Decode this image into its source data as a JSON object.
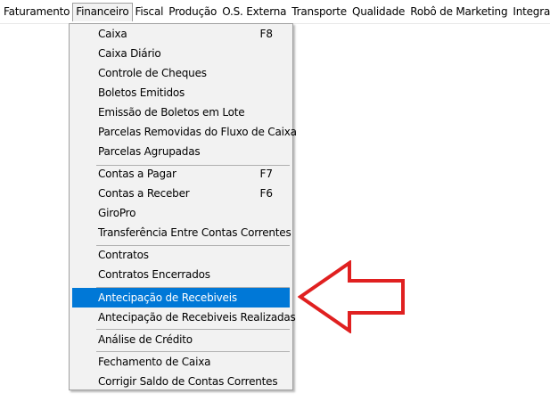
{
  "menubar": {
    "items": [
      {
        "label": "Faturamento"
      },
      {
        "label": "Financeiro"
      },
      {
        "label": "Fiscal"
      },
      {
        "label": "Produção"
      },
      {
        "label": "O.S. Externa"
      },
      {
        "label": "Transporte"
      },
      {
        "label": "Qualidade"
      },
      {
        "label": "Robô de Marketing"
      },
      {
        "label": "Integração"
      }
    ],
    "open_item": "Financeiro"
  },
  "dropdown": {
    "items": [
      {
        "label": "Caixa",
        "shortcut": "F8"
      },
      {
        "label": "Caixa Diário"
      },
      {
        "label": "Controle de Cheques"
      },
      {
        "label": "Boletos Emitidos"
      },
      {
        "label": "Emissão de Boletos em Lote"
      },
      {
        "label": "Parcelas Removidas do Fluxo de Caixa"
      },
      {
        "label": "Parcelas Agrupadas"
      },
      {
        "label": "Contas a Pagar",
        "shortcut": "F7"
      },
      {
        "label": "Contas a Receber",
        "shortcut": "F6"
      },
      {
        "label": "GiroPro"
      },
      {
        "label": "Transferência Entre Contas Correntes"
      },
      {
        "label": "Contratos"
      },
      {
        "label": "Contratos Encerrados"
      },
      {
        "label": "Antecipação de Recebiveis",
        "highlighted": true
      },
      {
        "label": "Antecipação de Recebiveis Realizadas"
      },
      {
        "label": "Análise de Crédito"
      },
      {
        "label": "Fechamento de Caixa"
      },
      {
        "label": "Corrigir Saldo de Contas Correntes"
      }
    ]
  },
  "colors": {
    "highlight": "#0078d7",
    "menu_background": "#f2f2f2",
    "annotation_arrow": "#e02020"
  },
  "annotation": {
    "icon": "arrow-left-icon"
  }
}
